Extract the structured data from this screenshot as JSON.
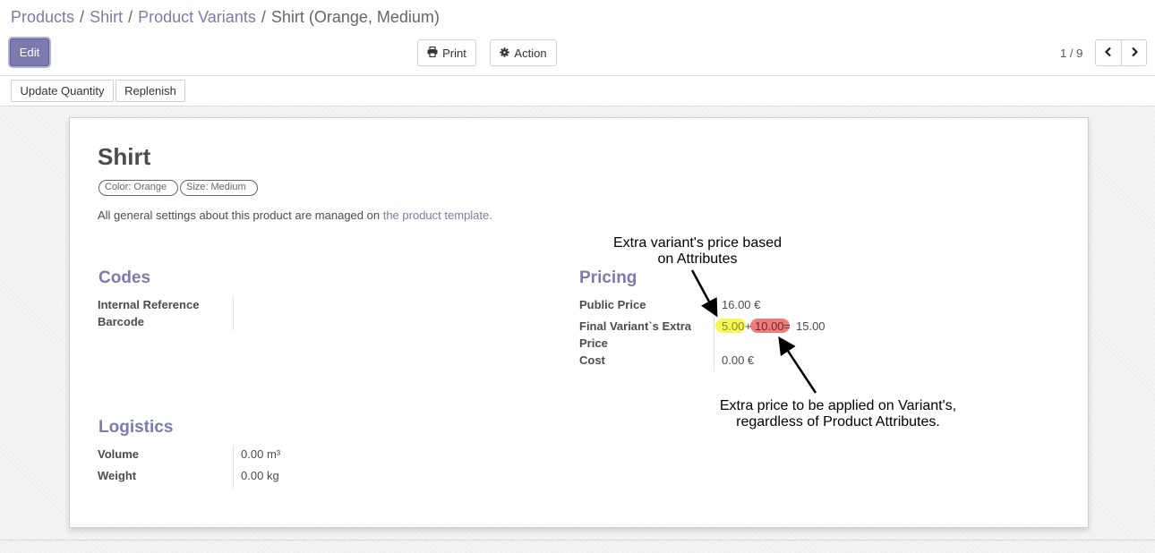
{
  "breadcrumb": {
    "items": [
      "Products",
      "Shirt",
      "Product Variants"
    ],
    "current": "Shirt (Orange, Medium)",
    "separator": "/"
  },
  "toolbar": {
    "edit_label": "Edit",
    "print_label": "Print",
    "action_label": "Action",
    "pager": "1 / 9",
    "prev_icon": "chevron-left-icon",
    "next_icon": "chevron-right-icon"
  },
  "subtoolbar": {
    "update_quantity_label": "Update Quantity",
    "replenish_label": "Replenish"
  },
  "product": {
    "name": "Shirt",
    "tags": [
      "Color: Orange",
      "Size: Medium"
    ],
    "info_prefix": "All general settings about this product are managed on",
    "info_link": "the product template."
  },
  "codes": {
    "title": "Codes",
    "internal_reference_label": "Internal Reference",
    "internal_reference_value": "",
    "barcode_label": "Barcode",
    "barcode_value": ""
  },
  "pricing": {
    "title": "Pricing",
    "public_price_label": "Public Price",
    "public_price_value": "16.00 €",
    "final_extra_label_line1": "Final Variant`s Extra",
    "final_extra_label_line2": "Price",
    "extra_attr_value": "5.00",
    "plus_sign": "+",
    "extra_variant_value": "10.00",
    "equals_sign": "=",
    "extra_total_value": "15.00",
    "cost_label": "Cost",
    "cost_value": "0.00 €"
  },
  "logistics": {
    "title": "Logistics",
    "volume_label": "Volume",
    "volume_value": "0.00",
    "volume_unit": "m³",
    "weight_label": "Weight",
    "weight_value": "0.00",
    "weight_unit": "kg"
  },
  "annotations": {
    "top_line1": "Extra variant's price based",
    "top_line2": "on Attributes",
    "bottom_line1": "Extra price to be applied on Variant's,",
    "bottom_line2": "regardless of Product Attributes."
  },
  "colors": {
    "accent": "#7c7bad",
    "highlight_attribute": "#f6f65a",
    "highlight_variant": "#f07b7b"
  }
}
